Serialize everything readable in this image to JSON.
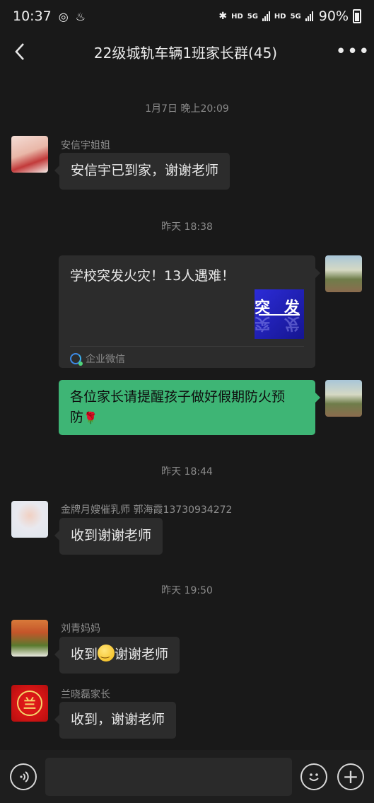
{
  "status": {
    "time": "10:37",
    "hd1": "HD",
    "net1": "5G",
    "hd2": "HD",
    "net2": "5G",
    "battery": "90%"
  },
  "header": {
    "title": "22级城轨车辆1班家长群(45)"
  },
  "messages": {
    "t1": "1月7日 晚上20:09",
    "m1": {
      "sender": "安信宇姐姐",
      "text": "安信宇已到家，谢谢老师"
    },
    "t2": "昨天 18:38",
    "card": {
      "title": "学校突发火灾！13人遇难！",
      "thumb_text": "突 发",
      "source": "企业微信"
    },
    "m3": {
      "text_line1": "各位家长请提醒孩子做好假期防火预",
      "text_line2": "防",
      "emoji": "🌹"
    },
    "t3": "昨天 18:44",
    "m4": {
      "sender": "金牌月嫂催乳师 郭海霞13730934272",
      "text": "收到谢谢老师"
    },
    "t4": "昨天 19:50",
    "m5": {
      "sender": "刘青妈妈",
      "text_a": "收到",
      "text_b": "谢谢老师"
    },
    "m6": {
      "sender": "兰晓磊家长",
      "text": "收到，谢谢老师"
    }
  },
  "icons": {
    "back": "chevron-left-icon",
    "more": "more-dots-icon",
    "voice": "voice-icon",
    "emoji": "emoji-icon",
    "plus": "plus-icon",
    "source": "wecom-icon"
  },
  "colors": {
    "background": "#191919",
    "bubble_in": "#2c2c2c",
    "bubble_out": "#3eb575",
    "timestamp": "#8a8a8a"
  }
}
